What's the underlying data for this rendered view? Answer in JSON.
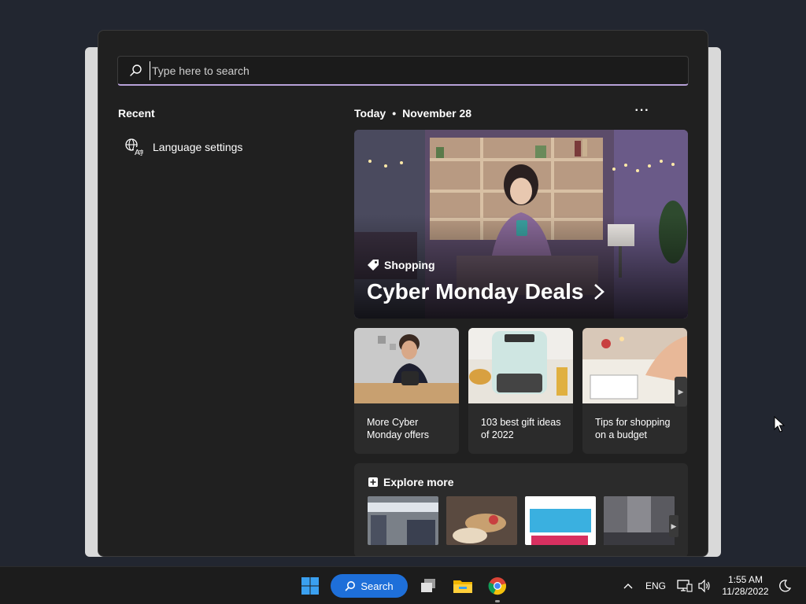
{
  "search": {
    "placeholder": "Type here to search"
  },
  "recent": {
    "title": "Recent",
    "items": [
      {
        "label": "Language settings",
        "icon": "language-settings-icon"
      }
    ]
  },
  "today": {
    "label": "Today",
    "date": "November 28",
    "more_icon": "more-dots-icon"
  },
  "hero": {
    "tag": "Shopping",
    "title": "Cyber Monday Deals"
  },
  "cards": [
    {
      "caption": "More Cyber Monday offers"
    },
    {
      "caption": "103 best gift ideas of 2022"
    },
    {
      "caption": "Tips for shopping on a budget"
    }
  ],
  "explore": {
    "title": "Explore more"
  },
  "taskbar": {
    "search_label": "Search",
    "language": "ENG",
    "time": "1:55 AM",
    "date": "11/28/2022",
    "icons": [
      "windows-start-icon",
      "task-view-icon",
      "file-explorer-icon",
      "chrome-icon"
    ]
  },
  "colors": {
    "accent_blue": "#1e6fd9",
    "search_underline": "#b7a1d8",
    "panel_bg": "#202020",
    "card_bg": "#2b2b2b"
  }
}
